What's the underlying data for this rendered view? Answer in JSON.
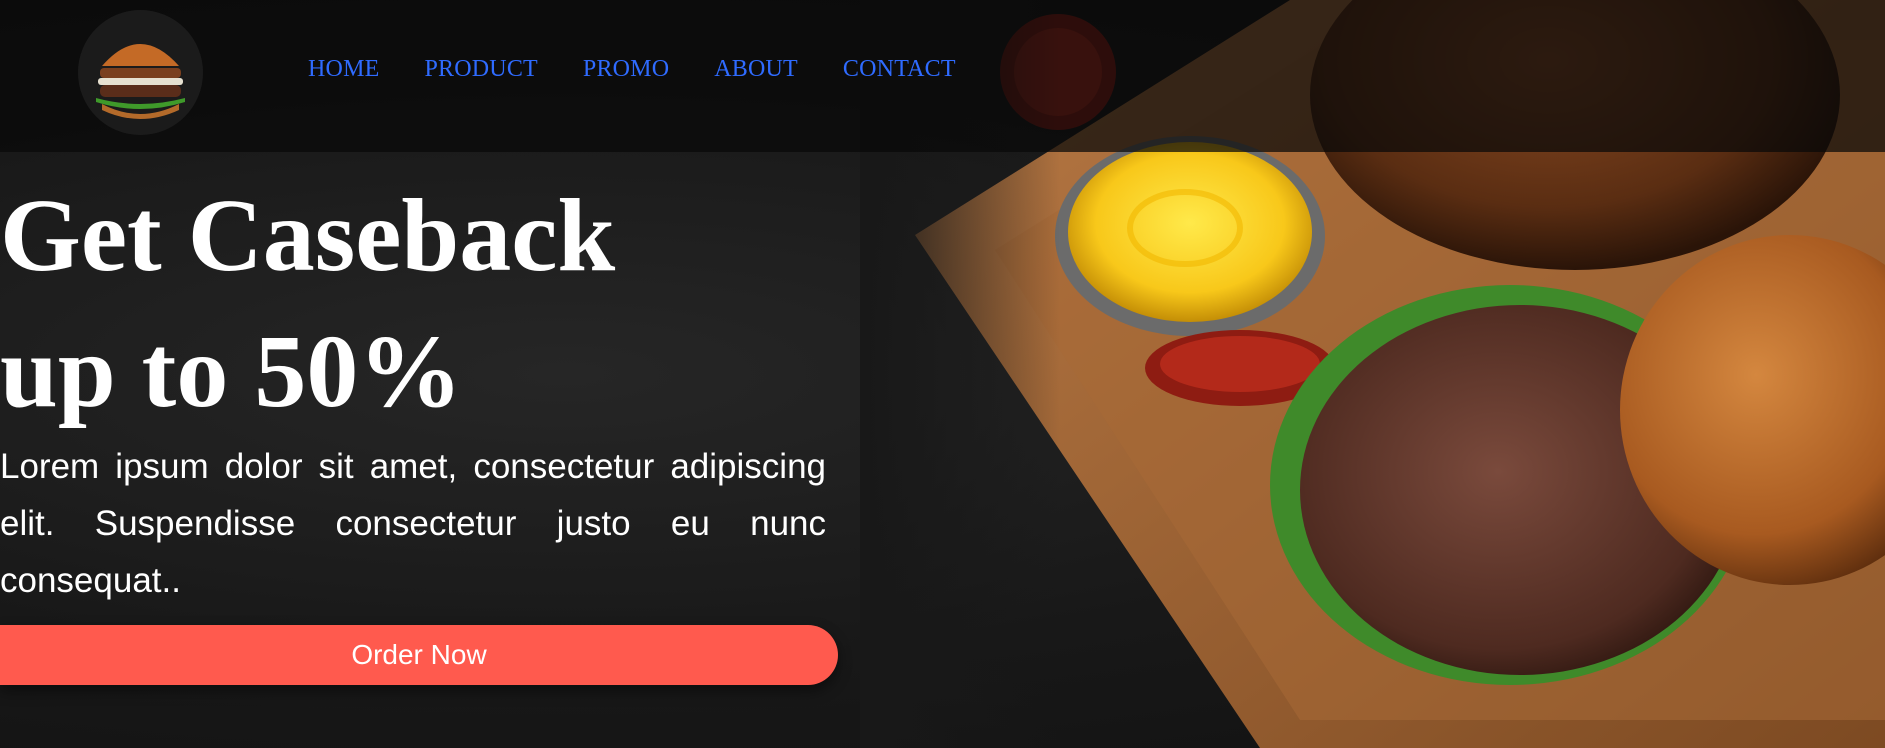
{
  "brand": {
    "logo_icon": "burger-logo-icon"
  },
  "nav": {
    "items": [
      {
        "label": "HOME"
      },
      {
        "label": "PRODUCT"
      },
      {
        "label": "PROMO"
      },
      {
        "label": "ABOUT"
      },
      {
        "label": "CONTACT"
      }
    ],
    "link_color": "#2f6bff"
  },
  "hero": {
    "title_line1": "Get Caseback",
    "title_line2": "up to 50%",
    "description": "Lorem ipsum dolor sit amet, consectetur adipiscing elit. Suspendisse consectetur justo eu nunc consequat..",
    "cta_label": "Order Now",
    "cta_color": "#ff5a4e",
    "image": "burger-with-mustard-on-board"
  }
}
